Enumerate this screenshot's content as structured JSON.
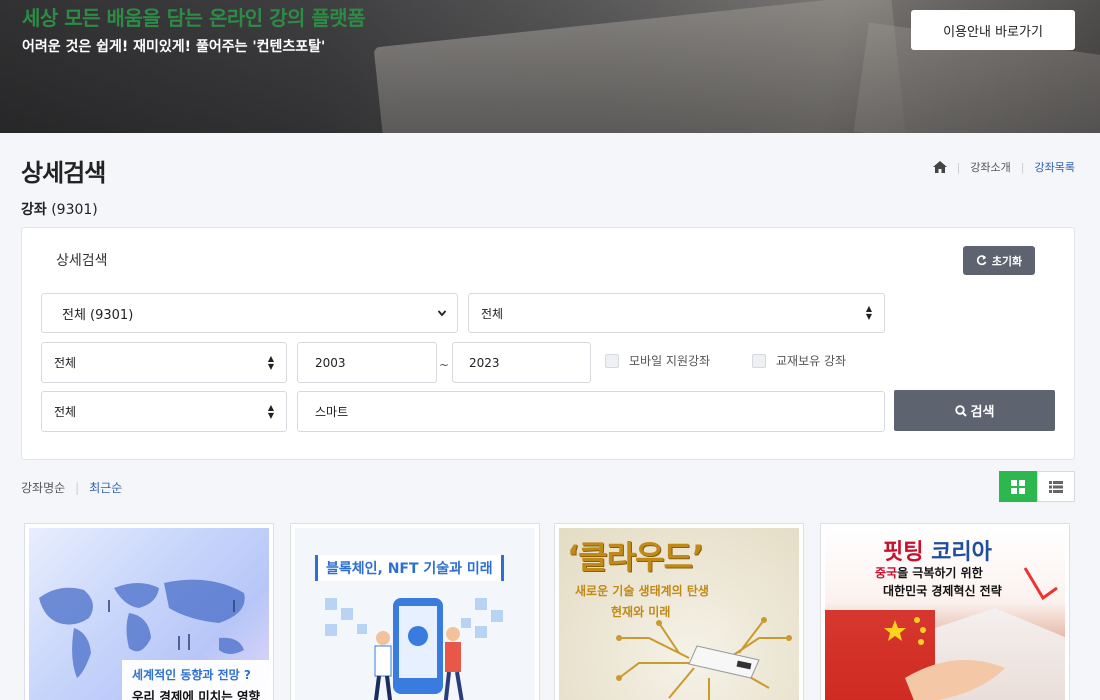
{
  "banner": {
    "title": "세상 모든 배움을 담는 온라인 강의 플랫폼",
    "subtitle": "어려운 것은 쉽게! 재미있게! 풀어주는 '컨텐츠포탈'",
    "guide_button": "이용안내 바로가기"
  },
  "page": {
    "title": "상세검색",
    "breadcrumb": [
      "강좌소개",
      "강좌목록"
    ],
    "count_label": "강좌",
    "count_value": "(9301)"
  },
  "search": {
    "panel_title": "상세검색",
    "reset_label": "초기화",
    "category_select": "전체 (9301)",
    "subcategory_select": "전체",
    "type_select": "전체",
    "year_from": "2003",
    "year_to": "2023",
    "range_separator": "~",
    "mobile_label": "모바일 지원강좌",
    "textbook_label": "교재보유 강좌",
    "field_select": "전체",
    "keyword": "스마트",
    "search_label": "검색"
  },
  "sort": {
    "options": [
      "강좌명순",
      "최근순"
    ],
    "active_index": 1
  },
  "cards": [
    {
      "line1": "세계적인 동향과 전망 ?",
      "line2": "우리 경제에 미치는 영향"
    },
    {
      "headline": "블록체인, NFT 기술과 미래"
    },
    {
      "big": "‘클라우드’",
      "line1": "새로운 기술 생태계의 탄생",
      "line2": "현재와 미래"
    },
    {
      "big_red": "핏팅",
      "big_blue": " 코리아",
      "line1_red": "중국",
      "line1_rest": "을 극복하기 위한",
      "line2": "대한민국 경제혁신 전략"
    }
  ],
  "colors": {
    "accent_green": "#2db84f",
    "link_blue": "#2f5fb3",
    "button_gray": "#5d6470"
  }
}
